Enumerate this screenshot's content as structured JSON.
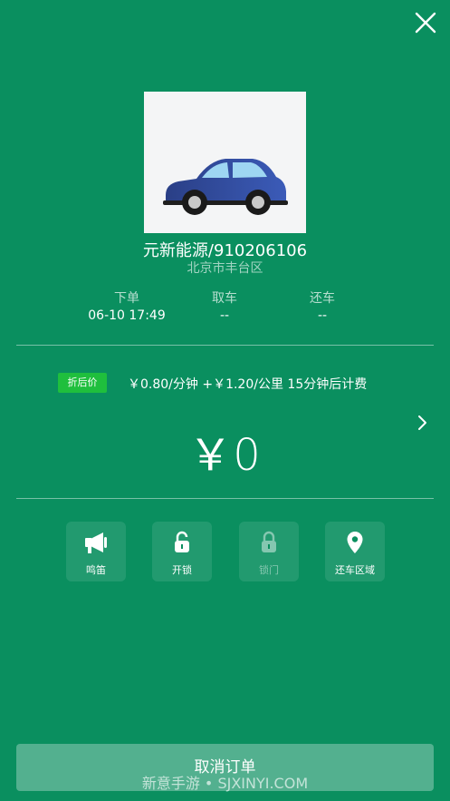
{
  "header": {
    "close_icon": "close-icon"
  },
  "vehicle": {
    "name": "元新能源/910206106",
    "location": "北京市丰台区"
  },
  "times": {
    "order": {
      "label": "下单",
      "value": "06-10 17:49"
    },
    "pickup": {
      "label": "取车",
      "value": "--"
    },
    "return": {
      "label": "还车",
      "value": "--"
    }
  },
  "pricing": {
    "badge": "折后价",
    "rate": "￥0.80/分钟 +￥1.20/公里 15分钟后计费",
    "total": "￥0"
  },
  "actions": [
    {
      "label": "鸣笛",
      "icon": "megaphone-icon",
      "enabled": true
    },
    {
      "label": "开锁",
      "icon": "unlock-icon",
      "enabled": true
    },
    {
      "label": "锁门",
      "icon": "lock-icon",
      "enabled": false
    },
    {
      "label": "还车区域",
      "icon": "location-pin-icon",
      "enabled": true
    }
  ],
  "footer": {
    "cancel_label": "取消订单",
    "watermark": "新意手游 • SJXINYI.COM"
  },
  "colors": {
    "background": "#0a8f5f",
    "badge": "#1fbf3d",
    "car_body": "#2f4e9c"
  }
}
